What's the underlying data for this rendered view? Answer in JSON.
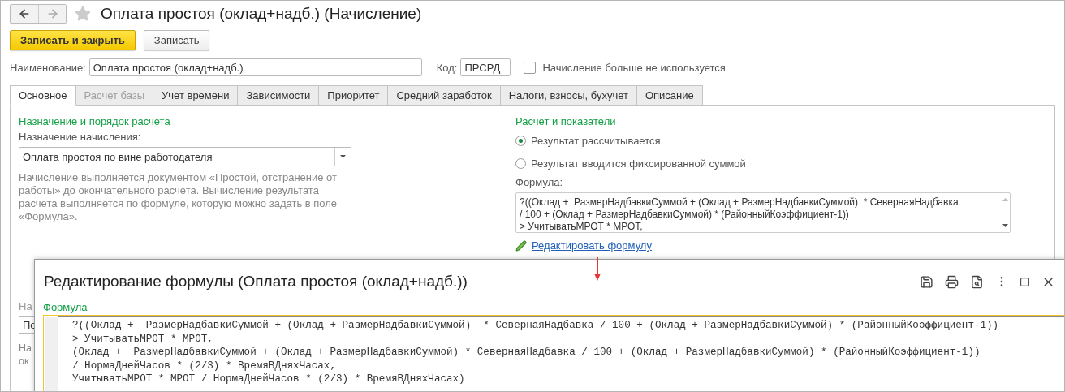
{
  "window": {
    "title": "Оплата простоя (оклад+надб.) (Начисление)"
  },
  "toolbar": {
    "buttons": [
      {
        "label": "Записать и закрыть",
        "kind": "primary"
      },
      {
        "label": "Записать",
        "kind": "default"
      }
    ]
  },
  "name_row": {
    "name_label": "Наименование:",
    "name_value": "Оплата простоя (оклад+надб.)",
    "code_label": "Код:",
    "code_value": "ПРСРД",
    "unused_checkbox": {
      "label": "Начисление больше не используется",
      "checked": false
    }
  },
  "tabs": [
    {
      "label": "Основное",
      "selected": true,
      "disabled": false
    },
    {
      "label": "Расчет базы",
      "selected": false,
      "disabled": true
    },
    {
      "label": "Учет времени",
      "selected": false,
      "disabled": false
    },
    {
      "label": "Зависимости",
      "selected": false,
      "disabled": false
    },
    {
      "label": "Приоритет",
      "selected": false,
      "disabled": false
    },
    {
      "label": "Средний заработок",
      "selected": false,
      "disabled": false
    },
    {
      "label": "Налоги, взносы, бухучет",
      "selected": false,
      "disabled": false
    },
    {
      "label": "Описание",
      "selected": false,
      "disabled": false
    }
  ],
  "purpose_section": {
    "title": "Назначение и порядок расчета",
    "field_label": "Назначение начисления:",
    "field_value": "Оплата простоя по вине работодателя",
    "description": "Начисление выполняется документом «Простой, отстранение от работы» до окончательного расчета. Вычисление результата расчета выполняется по формуле, которую можно задать в поле «Формула».",
    "covered_label": "На",
    "covered_field_value": "По",
    "covered_description": [
      "На",
      "ок"
    ]
  },
  "calculation_section": {
    "title": "Расчет и показатели",
    "result_options": [
      {
        "label": "Результат рассчитывается",
        "selected": true
      },
      {
        "label": "Результат вводится фиксированной суммой",
        "selected": false
      }
    ],
    "formula_label": "Формула:",
    "formula_lines": [
      "?((Оклад +  РазмерНадбавкиСуммой + (Оклад + РазмерНадбавкиСуммой)  * СевернаяНадбавка",
      "/ 100 + (Оклад + РазмерНадбавкиСуммой) * (РайонныйКоэффициент-1))",
      "> УчитыватьМРОТ * МРОТ,"
    ],
    "edit_link": "Редактировать формулу"
  },
  "formula_dialog": {
    "title": "Редактирование формулы (Оплата простоя (оклад+надб.))",
    "field_label": "Формула",
    "formula_lines": [
      "?((Оклад +  РазмерНадбавкиСуммой + (Оклад + РазмерНадбавкиСуммой)  * СевернаяНадбавка / 100 + (Оклад + РазмерНадбавкиСуммой) * (РайонныйКоэффициент-1))",
      "> УчитыватьМРОТ * МРОТ,",
      "(Оклад +  РазмерНадбавкиСуммой + (Оклад + РазмерНадбавкиСуммой) * СевернаяНадбавка / 100 + (Оклад + РазмерНадбавкиСуммой) * (РайонныйКоэффициент-1))",
      "/ НормаДнейЧасов * (2/3) * ВремяВДняхЧасах,",
      "УчитыватьМРОТ * МРОТ / НормаДнейЧасов * (2/3) * ВремяВДняхЧасах)"
    ]
  }
}
